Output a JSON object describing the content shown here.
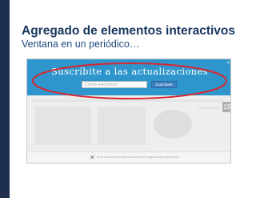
{
  "slide": {
    "title": "Agregado de elementos interactivos",
    "subtitle": "Ventana en un periódico…"
  },
  "popup": {
    "title": "Suscríbite a las actualizaciones",
    "email_placeholder": "Correo electrónico",
    "subscribe_label": "Suscríbete"
  },
  "page": {
    "date_badge": "19",
    "bottom_notice": "Si no desea recibir este aviso de nuevo, haga clic aquí para cerrar."
  },
  "colors": {
    "title": "#17365d",
    "popup_band": "#2e96cc",
    "highlight": "#d9262e"
  },
  "icons": [
    "close-icon",
    "close-x-icon"
  ]
}
